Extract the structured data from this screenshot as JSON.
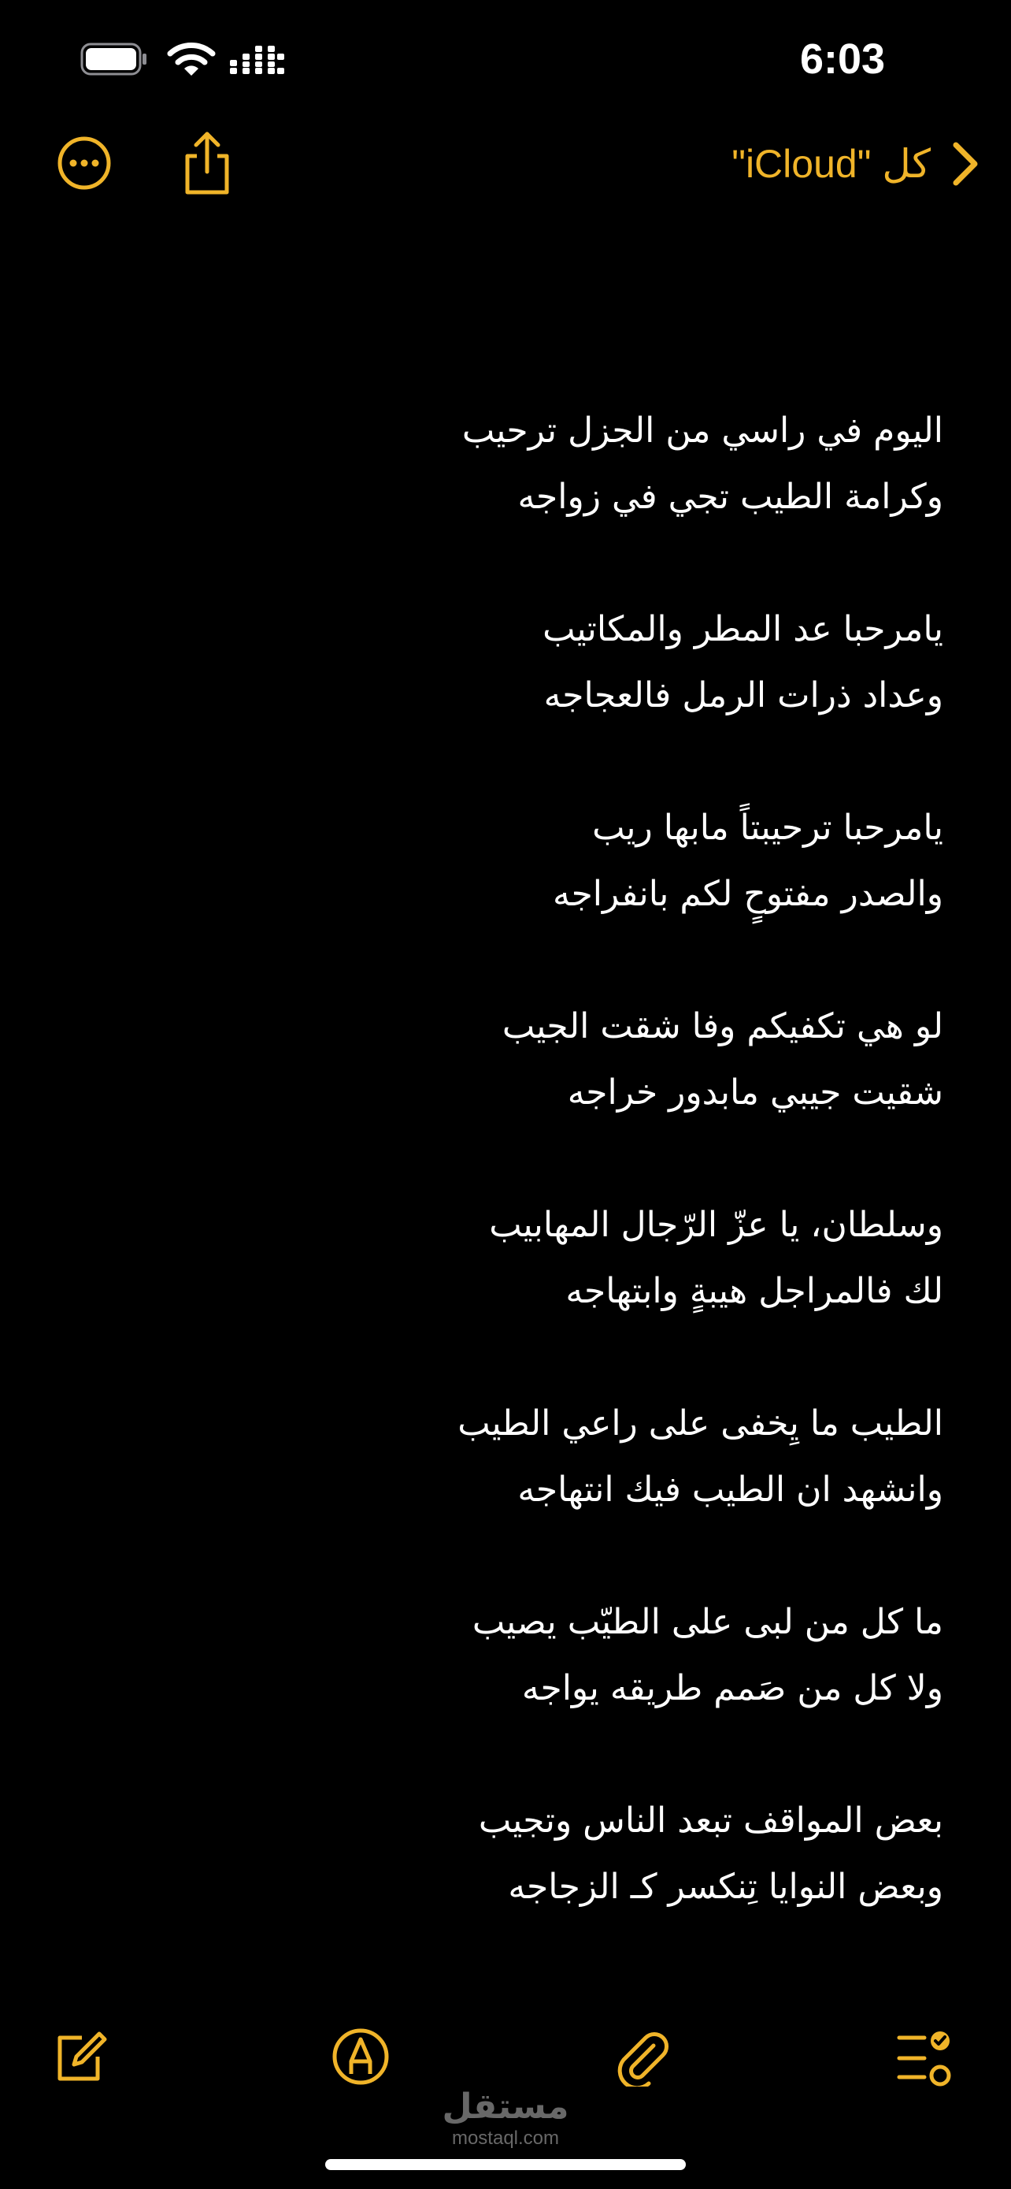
{
  "status_bar": {
    "time": "6:03",
    "icons": [
      "battery-icon",
      "wifi-icon",
      "signal-icon"
    ]
  },
  "nav_bar": {
    "back_label": "كل \"iCloud\"",
    "icons": [
      "chevron-right-icon",
      "share-icon",
      "more-icon"
    ]
  },
  "note": {
    "stanzas": [
      [
        "اليوم في راسي من الجزل ترحيب",
        "وكرامة الطيب تجي في زواجه"
      ],
      [
        "يامرحبا عد المطر والمكاتيب",
        "وعداد ذرات الرمل فالعجاجه"
      ],
      [
        "يامرحبا ترحيبتاً مابها ريب",
        "والصدر مفتوحٍ لكم بانفراجه"
      ],
      [
        "لو هي تكفيكم وفا شقت الجيب",
        "شقيت جيبي مابدور خراجه"
      ],
      [
        "وسلطان، يا عزّ الرّجال المهابيب",
        "لك فالمراجل هيبةٍ وابتهاجه"
      ],
      [
        "الطيب ما يِخفى على راعي الطيب",
        "وانشهد ان الطيب فيك انتهاجه"
      ],
      [
        "ما كل من لبى على الطيّب يصيب",
        "ولا كل من صَمم طريقه يواجه"
      ],
      [
        "بعض المواقف تبعد الناس وتجيب",
        "وبعض النوايا تِنكسر كـ الزجاجه"
      ]
    ]
  },
  "toolbar": {
    "icons": [
      "compose-icon",
      "markup-icon",
      "attachment-icon",
      "checklist-icon"
    ]
  },
  "watermark": {
    "logo": "مستقل",
    "domain": "mostaql.com"
  },
  "colors": {
    "background": "#000000",
    "accent": "#f0b429",
    "text": "#ffffff"
  }
}
